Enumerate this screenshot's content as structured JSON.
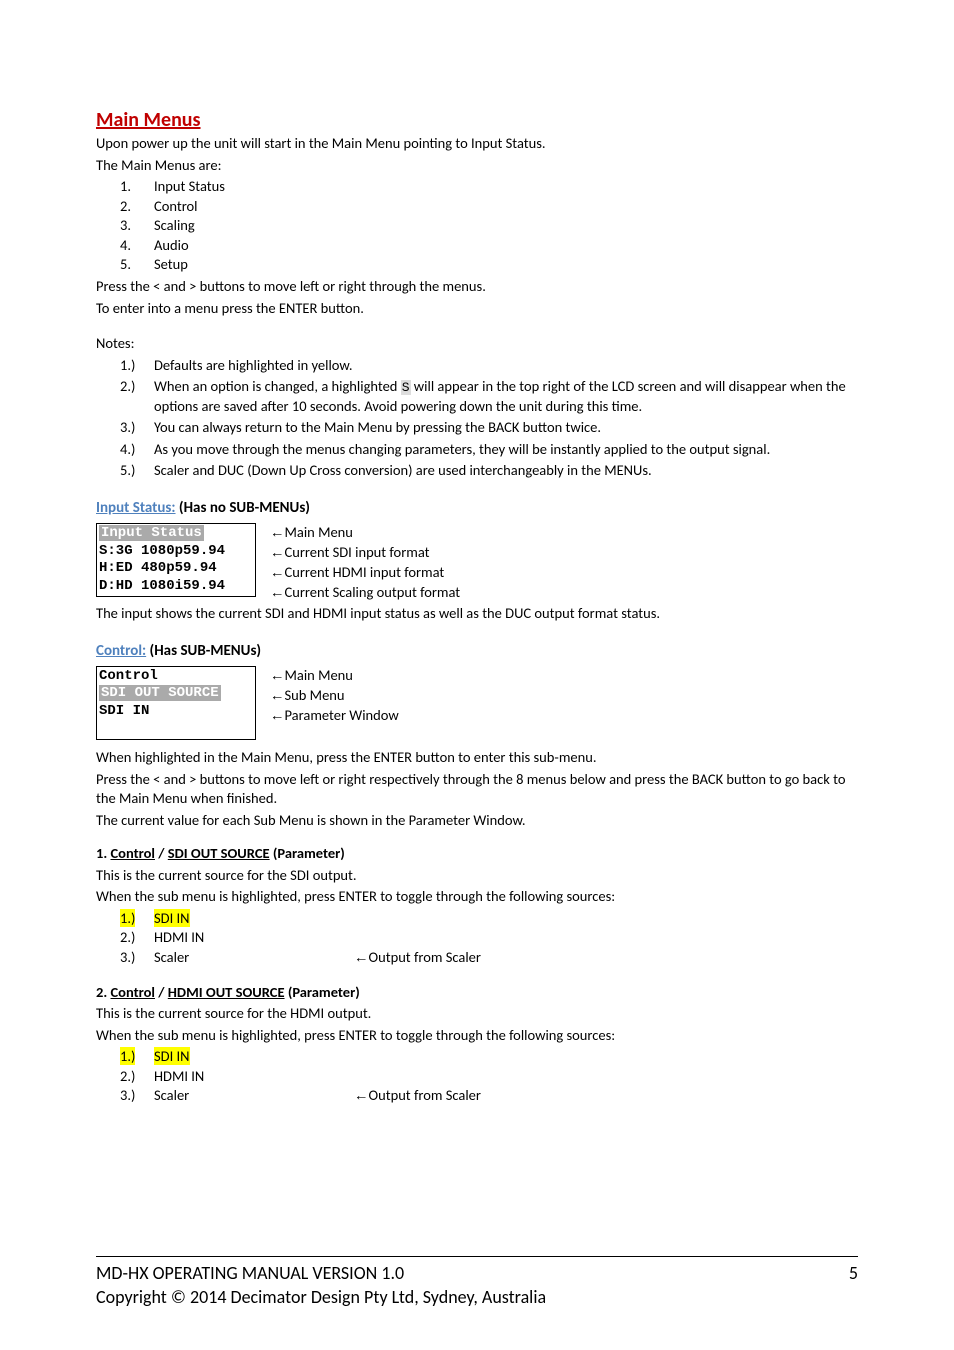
{
  "title": "Main Menus",
  "intro1": "Upon power up the unit will start in the Main Menu pointing to Input Status.",
  "intro2": "The Main Menus are:",
  "menuItems": [
    "Input Status",
    "Control",
    "Scaling",
    "Audio",
    "Setup"
  ],
  "intro3": "Press the < and > buttons to move left or right through the menus.",
  "intro4": "To enter into a menu press the ENTER button.",
  "notesHeader": "Notes:",
  "notes": {
    "n1": "Defaults are highlighted in yellow.",
    "n2a": "When an option is changed, a highlighted ",
    "n2s": "S",
    "n2b": " will appear in the top right of the LCD screen and will disappear when the options are saved after 10 seconds.  Avoid powering down the unit during this time.",
    "n3": "You can always return to the Main Menu by pressing the BACK button twice.",
    "n4": "As you move through the menus changing parameters, they will be instantly applied to the output signal.",
    "n5": "Scaler and DUC (Down Up Cross conversion) are used interchangeably in the MENUs."
  },
  "sec1": {
    "titleBlue": "Input Status:",
    "titleRest": " (Has no SUB-MENUs)",
    "lcd": {
      "l1": "Input Status",
      "l2": "S:3G 1080p59.94",
      "l3": "H:ED 480p59.94",
      "l4": "D:HD 1080i59.94"
    },
    "ann": {
      "a1": "Main Menu",
      "a2": "Current SDI input format",
      "a3": "Current HDMI input format",
      "a4": "Current Scaling output format"
    },
    "note": "The input shows the current SDI and HDMI input status as well as the DUC output format status."
  },
  "sec2": {
    "titleBlue": "Control:",
    "titleRest": " (Has SUB-MENUs)",
    "lcd": {
      "l1": "Control",
      "l2": "SDI OUT SOURCE",
      "l3": "SDI IN"
    },
    "ann": {
      "a1": "Main Menu",
      "a2": "Sub Menu",
      "a3": "Parameter Window"
    },
    "p1": "When highlighted in the Main Menu, press the ENTER button to enter this sub-menu.",
    "p2": "Press the < and > buttons to move left or right respectively through the 8 menus below and press the BACK button to go back to the Main Menu when finished.",
    "p3": "The current value for each Sub Menu is shown in the Parameter Window."
  },
  "param1": {
    "head_pre": "1. ",
    "head_u1": "Control",
    "head_mid": " / ",
    "head_u2": "SDI OUT SOURCE",
    "head_post": " (Parameter)",
    "p1": "This is the current source for the SDI output.",
    "p2": "When the sub menu is highlighted, press ENTER to toggle through the following sources:",
    "opts": {
      "o1m": "1.)",
      "o1": "SDI IN",
      "o2m": "2.)",
      "o2": "HDMI IN",
      "o3m": "3.)",
      "o3": "Scaler",
      "o3ann": "Output from Scaler"
    }
  },
  "param2": {
    "head_pre": "2. ",
    "head_u1": "Control",
    "head_mid": " / ",
    "head_u2": "HDMI OUT SOURCE",
    "head_post": " (Parameter)",
    "p1": "This is the current source for the HDMI output.",
    "p2": "When the sub menu is highlighted, press ENTER to toggle through the following sources:",
    "opts": {
      "o1m": "1.)",
      "o1": "SDI IN",
      "o2m": "2.)",
      "o2": "HDMI IN",
      "o3m": "3.)",
      "o3": "Scaler",
      "o3ann": "Output from Scaler"
    }
  },
  "footer": {
    "line1": "MD-HX OPERATING MANUAL VERSION 1.0",
    "page": "5",
    "line2": "Copyright © 2014 Decimator Design Pty Ltd, Sydney, Australia"
  },
  "arrow": "←"
}
